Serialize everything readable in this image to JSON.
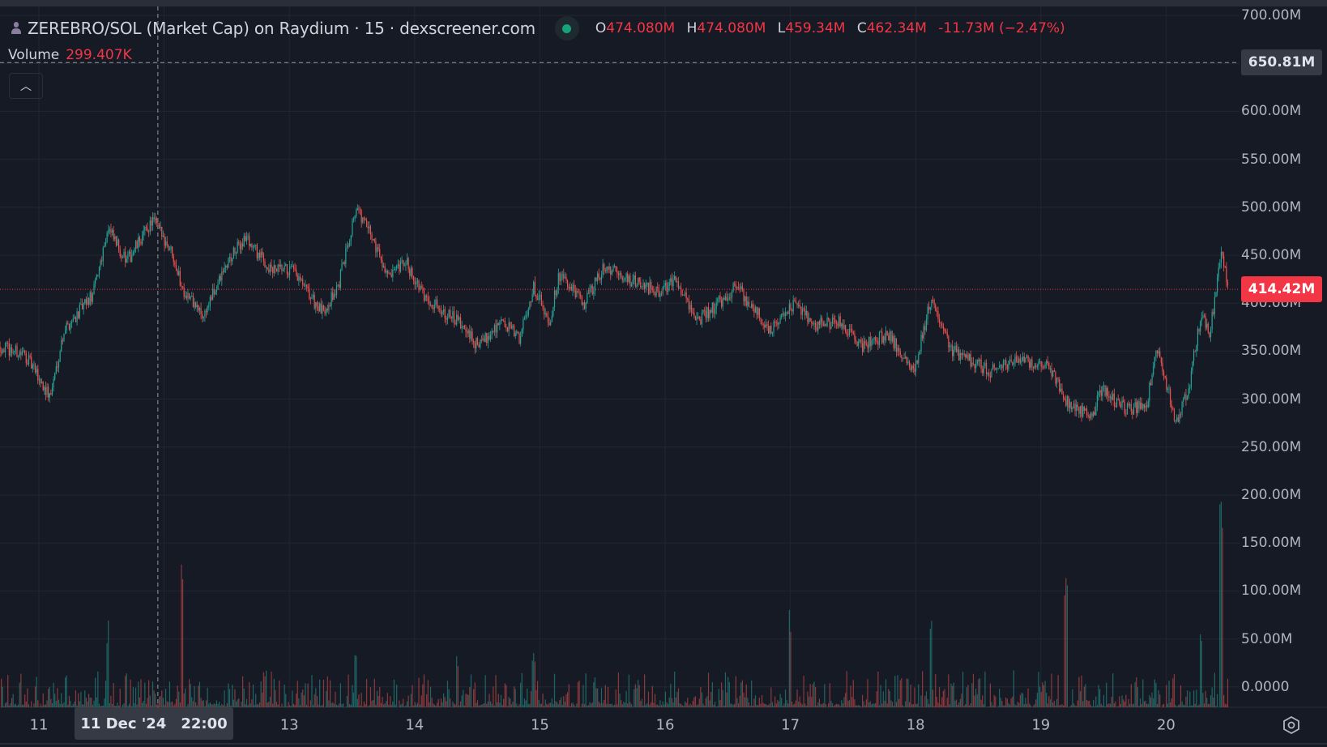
{
  "header": {
    "title": "ZEREBRO/SOL (Market Cap) on Raydium · 15 · dexscreener.com",
    "ohlc": {
      "o_key": "O",
      "o": "474.080M",
      "h_key": "H",
      "h": "474.080M",
      "l_key": "L",
      "l": "459.34M",
      "c_key": "C",
      "c": "462.34M",
      "change": "-11.73M (−2.47%)"
    },
    "volume_label": "Volume",
    "volume_value": "299.407K",
    "collapse_icon": "chevron-up-icon"
  },
  "price_axis": {
    "ticks": [
      "700.00M",
      "600.00M",
      "550.00M",
      "500.00M",
      "450.00M",
      "400.00M",
      "350.00M",
      "300.00M",
      "250.00M",
      "200.00M",
      "150.00M",
      "100.00M",
      "50.00M",
      "0.0000"
    ],
    "tick_values": [
      700,
      600,
      550,
      500,
      450,
      400,
      350,
      300,
      250,
      200,
      150,
      100,
      50,
      0
    ],
    "crosshair_label": "650.81M",
    "crosshair_value": 650.81,
    "last_price_label": "414.42M",
    "last_price_value": 414.42
  },
  "time_axis": {
    "ticks": [
      {
        "label": "11",
        "day": 0
      },
      {
        "label": "13",
        "day": 2
      },
      {
        "label": "14",
        "day": 3
      },
      {
        "label": "15",
        "day": 4
      },
      {
        "label": "16",
        "day": 5
      },
      {
        "label": "17",
        "day": 6
      },
      {
        "label": "18",
        "day": 7
      },
      {
        "label": "19",
        "day": 8
      },
      {
        "label": "20",
        "day": 9
      }
    ],
    "crosshair_date": "11 Dec '24",
    "crosshair_time": "22:00",
    "crosshair_day": 0.95
  },
  "colors": {
    "up": "#26a69a",
    "down": "#ef5350",
    "bg": "#161a25",
    "grid": "#222631",
    "accent_red": "#f23645"
  },
  "chart_data": {
    "type": "candlestick",
    "interval_minutes": 15,
    "x_unit": "days since 11 Dec 2024 00:00",
    "y_unit": "market cap (M)",
    "ylim": [
      0,
      700
    ],
    "xlim": [
      -0.31,
      9.5
    ],
    "price_path": [
      [
        -0.31,
        355
      ],
      [
        -0.11,
        346
      ],
      [
        0.09,
        302
      ],
      [
        0.2,
        372
      ],
      [
        0.43,
        408
      ],
      [
        0.55,
        478
      ],
      [
        0.7,
        443
      ],
      [
        0.91,
        487
      ],
      [
        1.07,
        452
      ],
      [
        1.14,
        417
      ],
      [
        1.31,
        386
      ],
      [
        1.51,
        443
      ],
      [
        1.65,
        469
      ],
      [
        1.85,
        434
      ],
      [
        2.02,
        434
      ],
      [
        2.26,
        390
      ],
      [
        2.39,
        417
      ],
      [
        2.53,
        500
      ],
      [
        2.66,
        469
      ],
      [
        2.8,
        425
      ],
      [
        2.93,
        443
      ],
      [
        3.07,
        408
      ],
      [
        3.34,
        381
      ],
      [
        3.51,
        355
      ],
      [
        3.68,
        381
      ],
      [
        3.84,
        364
      ],
      [
        3.95,
        417
      ],
      [
        4.08,
        381
      ],
      [
        4.15,
        430
      ],
      [
        4.35,
        399
      ],
      [
        4.52,
        439
      ],
      [
        4.69,
        425
      ],
      [
        4.96,
        412
      ],
      [
        5.09,
        425
      ],
      [
        5.26,
        381
      ],
      [
        5.57,
        417
      ],
      [
        5.84,
        372
      ],
      [
        6.04,
        399
      ],
      [
        6.18,
        377
      ],
      [
        6.38,
        381
      ],
      [
        6.58,
        355
      ],
      [
        6.78,
        368
      ],
      [
        6.99,
        329
      ],
      [
        7.12,
        404
      ],
      [
        7.29,
        351
      ],
      [
        7.59,
        329
      ],
      [
        7.8,
        342
      ],
      [
        8.07,
        333
      ],
      [
        8.2,
        298
      ],
      [
        8.41,
        280
      ],
      [
        8.47,
        311
      ],
      [
        8.68,
        289
      ],
      [
        8.84,
        293
      ],
      [
        8.93,
        351
      ],
      [
        9.08,
        276
      ],
      [
        9.18,
        311
      ],
      [
        9.28,
        390
      ],
      [
        9.35,
        368
      ],
      [
        9.44,
        452
      ],
      [
        9.5,
        413
      ]
    ],
    "volume_spikes": [
      [
        0.55,
        65
      ],
      [
        1.14,
        130
      ],
      [
        2.53,
        50
      ],
      [
        3.34,
        40
      ],
      [
        3.95,
        45
      ],
      [
        6.0,
        75
      ],
      [
        7.12,
        80
      ],
      [
        8.2,
        105
      ],
      [
        9.28,
        65
      ],
      [
        9.44,
        185
      ]
    ]
  }
}
